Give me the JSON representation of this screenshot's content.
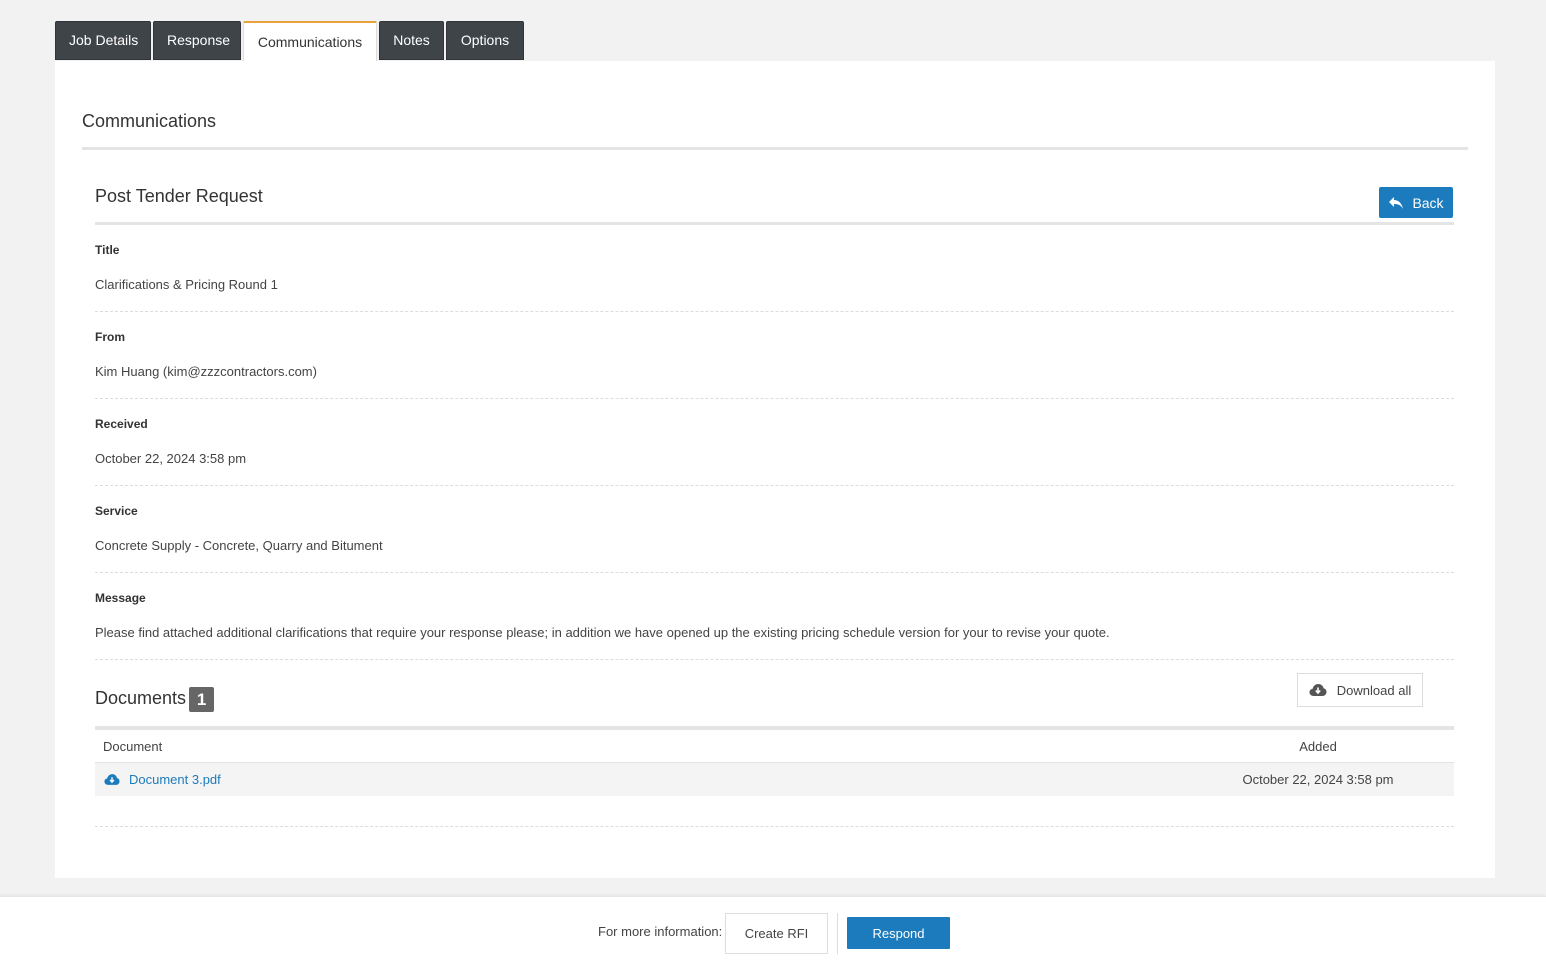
{
  "tabs": [
    {
      "label": "Job Details",
      "active": false
    },
    {
      "label": "Response",
      "active": false
    },
    {
      "label": "Communications",
      "active": true
    },
    {
      "label": "Notes",
      "active": false
    },
    {
      "label": "Options",
      "active": false
    }
  ],
  "section": {
    "title": "Communications"
  },
  "request": {
    "title": "Post Tender Request",
    "back_label": "Back",
    "fields": [
      {
        "label": "Title",
        "value": "Clarifications & Pricing Round 1"
      },
      {
        "label": "From",
        "value": "Kim Huang (kim@zzzcontractors.com)"
      },
      {
        "label": "Received",
        "value": "October 22, 2024 3:58 pm"
      },
      {
        "label": "Service",
        "value": "Concrete Supply - Concrete, Quarry and Bitument"
      },
      {
        "label": "Message",
        "value": "Please find attached additional clarifications that require your response please; in addition we have opened up the existing pricing schedule version for your to revise your quote."
      }
    ]
  },
  "documents": {
    "title": "Documents",
    "count": "1",
    "download_all_label": "Download all",
    "columns": [
      "Document",
      "Added"
    ],
    "rows": [
      {
        "name": "Document 3.pdf",
        "added": "October 22, 2024 3:58 pm"
      }
    ]
  },
  "footer": {
    "more_info_label": "For more information:",
    "create_rfi_label": "Create RFI",
    "respond_label": "Respond"
  },
  "colors": {
    "accent": "#1b7bbd",
    "tab_dark": "#3f4448",
    "tab_active_border": "#e8a33d"
  }
}
